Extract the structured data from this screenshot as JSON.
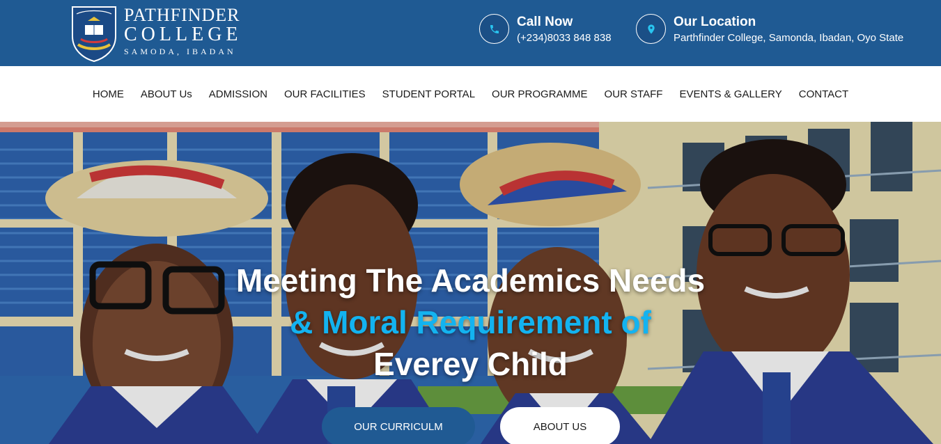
{
  "header": {
    "logo": {
      "line1": "PATHFINDER",
      "line2": "COLLEGE",
      "line3": "SAMODA, IBADAN",
      "crest_text": "PATHFINDER COLLEGE"
    },
    "call": {
      "icon": "phone-icon",
      "title": "Call Now",
      "value": "(+234)8033 848 838"
    },
    "location": {
      "icon": "map-pin-icon",
      "title": "Our Location",
      "value": "Parthfinder College, Samonda, Ibadan, Oyo State"
    }
  },
  "nav": {
    "items": [
      "HOME",
      "ABOUT Us",
      "ADMISSION",
      "OUR FACILITIES",
      "STUDENT PORTAL",
      "OUR PROGRAMME",
      "OUR STAFF",
      "EVENTS & GALLERY",
      "CONTACT"
    ]
  },
  "hero": {
    "line1": "Meeting The Academics Needs",
    "line2": "& Moral Requirement of",
    "line3": "Everey Child",
    "primary_button": "OUR CURRICULM",
    "secondary_button": "ABOUT US"
  },
  "colors": {
    "header_bg": "#1f5a93",
    "accent_text": "#13b3f0",
    "primary_button": "#205a93"
  }
}
